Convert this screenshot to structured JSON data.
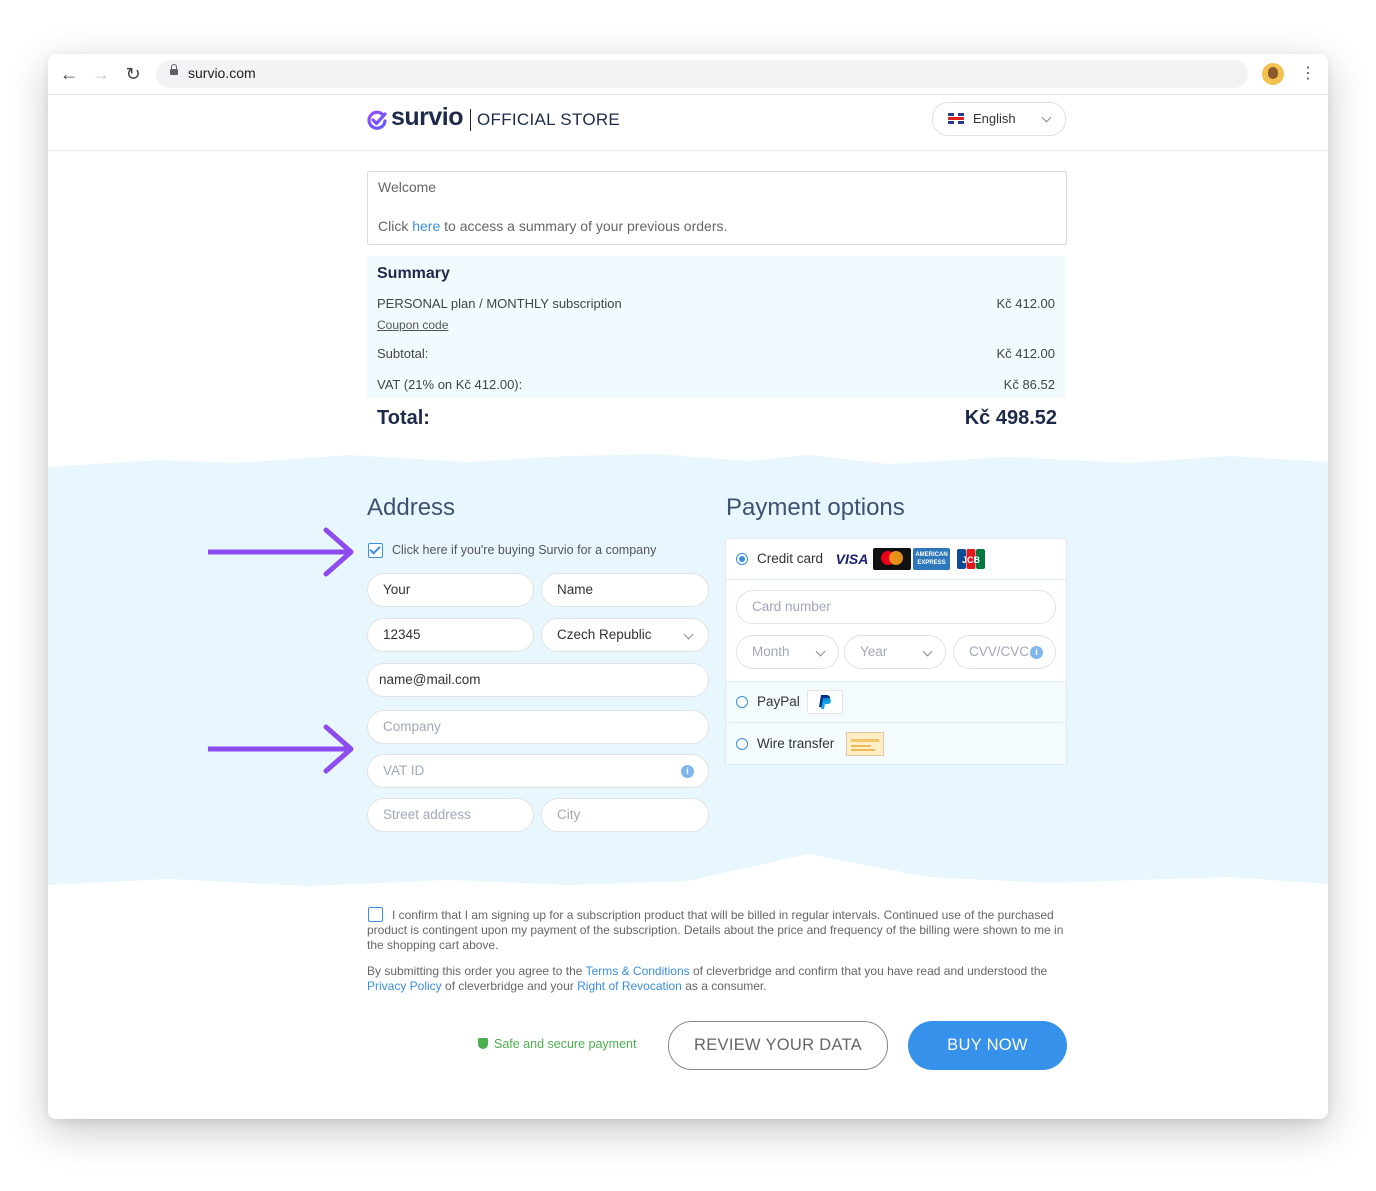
{
  "browser": {
    "url": "survio.com"
  },
  "header": {
    "logo_text": "survio",
    "store_label": "OFFICIAL STORE",
    "language": "English"
  },
  "welcome": {
    "title": "Welcome",
    "line_prefix": "Click",
    "link": "here",
    "line_suffix": "to access a summary of your previous orders."
  },
  "summary": {
    "title": "Summary",
    "item_label": "PERSONAL plan / MONTHLY subscription",
    "item_price": "Kč 412.00",
    "coupon": "Coupon code",
    "subtotal_label": "Subtotal:",
    "subtotal_value": "Kč 412.00",
    "vat_label": "VAT (21% on Kč 412.00):",
    "vat_value": "Kč 86.52",
    "total_label": "Total:",
    "total_value": "Kč 498.52"
  },
  "address": {
    "title": "Address",
    "company_checkbox_label": "Click here if you're buying Survio for a company",
    "company_checked": true,
    "first_name": "Your",
    "last_name": "Name",
    "zip": "12345",
    "country": "Czech Republic",
    "email": "name@mail.com",
    "company_placeholder": "Company",
    "vat_placeholder": "VAT ID",
    "street_placeholder": "Street address",
    "city_placeholder": "City"
  },
  "payment": {
    "title": "Payment options",
    "credit_card_label": "Credit card",
    "card_brands": [
      "VISA",
      "mastercard",
      "AMERICAN EXPRESS",
      "JCB"
    ],
    "card_number_placeholder": "Card number",
    "month_placeholder": "Month",
    "year_placeholder": "Year",
    "cvv_placeholder": "CVV/CVC",
    "paypal_label": "PayPal",
    "wire_label": "Wire transfer",
    "selected": "Credit card"
  },
  "legal": {
    "confirm_text": "I confirm that I am signing up for a subscription product that will be billed in regular intervals. Continued use of the purchased product is contingent upon my payment of the subscription. Details about the price and frequency of the billing were shown to me in the shopping cart above.",
    "terms_prefix": "By submitting this order you agree to the",
    "terms_link": "Terms & Conditions",
    "terms_mid": "of cleverbridge and confirm that you have read and understood the",
    "privacy_link": "Privacy Policy",
    "terms_mid2": "of cleverbridge and your",
    "revocation_link": "Right of Revocation",
    "terms_suffix": "as a consumer."
  },
  "actions": {
    "secure_label": "Safe and secure payment",
    "review_button": "REVIEW YOUR DATA",
    "buy_button": "BUY NOW"
  },
  "colors": {
    "accent": "#3591ea",
    "annotation_arrow": "#8c4cf0",
    "band": "#e8f7fd",
    "heading": "#1e2a4a"
  }
}
